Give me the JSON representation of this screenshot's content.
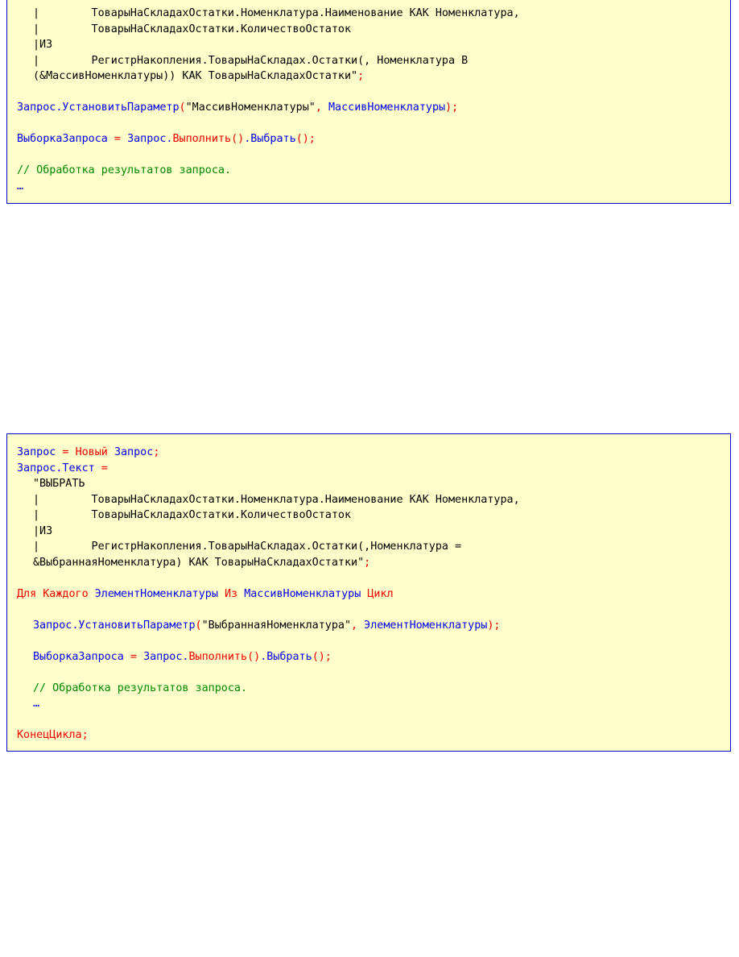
{
  "block1": {
    "l1_bar": "|",
    "l1_text": "        ТоварыНаСкладахОстатки.Номенклатура.Наименование КАК Номенклатура,",
    "l2_bar": "|",
    "l2_text": "        ТоварыНаСкладахОстатки.КоличествоОстаток",
    "l3": "|ИЗ",
    "l4_bar": "|",
    "l4_text": "        РегистрНакопления.ТоварыНаСкладах.Остатки(, Номенклатура В",
    "l5_text": "(&МассивНоменклатуры)) КАК ТоварыНаСкладахОстатки\"",
    "l5_semi": ";",
    "l7_obj": "Запрос.УстановитьПараметр",
    "l7_open": "(",
    "l7_str": "\"МассивНоменклатуры\"",
    "l7_comma": ", ",
    "l7_arg": "МассивНоменклатуры",
    "l7_close": ");",
    "l9_var": "ВыборкаЗапроса",
    "l9_eq": " = ",
    "l9_obj": "Запрос.",
    "l9_run": "Выполнить",
    "l9_p1": "()",
    "l9_dot": ".",
    "l9_sel": "Выбрать",
    "l9_p2": "();",
    "l11_comment": "// Обработка результатов запроса.",
    "l12_ellipsis": "…"
  },
  "block2": {
    "l1_var": "Запрос",
    "l1_eq": " = ",
    "l1_new": "Новый",
    "l1_sp": " ",
    "l1_type": "Запрос",
    "l1_semi": ";",
    "l2_var": "Запрос.Текст",
    "l2_eq": " =",
    "l3": "\"ВЫБРАТЬ",
    "l4_bar": "|",
    "l4_text": "        ТоварыНаСкладахОстатки.Номенклатура.Наименование КАК Номенклатура,",
    "l5_bar": "|",
    "l5_text": "        ТоварыНаСкладахОстатки.КоличествоОстаток",
    "l6": "|ИЗ",
    "l7_bar": "|",
    "l7_text": "        РегистрНакопления.ТоварыНаСкладах.Остатки(,Номенклатура =",
    "l8_text": "&ВыбраннаяНоменклатура) КАК ТоварыНаСкладахОстатки\"",
    "l8_semi": ";",
    "l10_for": "Для Каждого",
    "l10_sp1": " ",
    "l10_elem": "ЭлементНоменклатуры",
    "l10_sp2": " ",
    "l10_in": "Из",
    "l10_sp3": " ",
    "l10_arr": "МассивНоменклатуры",
    "l10_sp4": " ",
    "l10_loop": "Цикл",
    "l12_obj": "Запрос.УстановитьПараметр",
    "l12_open": "(",
    "l12_str": "\"ВыбраннаяНоменклатура\"",
    "l12_comma": ", ",
    "l12_arg": "ЭлементНоменклатуры",
    "l12_close": ");",
    "l14_var": "ВыборкаЗапроса",
    "l14_eq": " = ",
    "l14_obj": "Запрос.",
    "l14_run": "Выполнить",
    "l14_p1": "()",
    "l14_dot": ".",
    "l14_sel": "Выбрать",
    "l14_p2": "();",
    "l16_comment": "// Обработка результатов запроса.",
    "l17_ellipsis": "…",
    "l19_end": "КонецЦикла;"
  },
  "colors": {
    "background": "#ffffcc",
    "border": "#0000cc",
    "keyword": "#ee0000",
    "identifier": "#0000ee",
    "comment": "#008800",
    "text": "#000000"
  }
}
